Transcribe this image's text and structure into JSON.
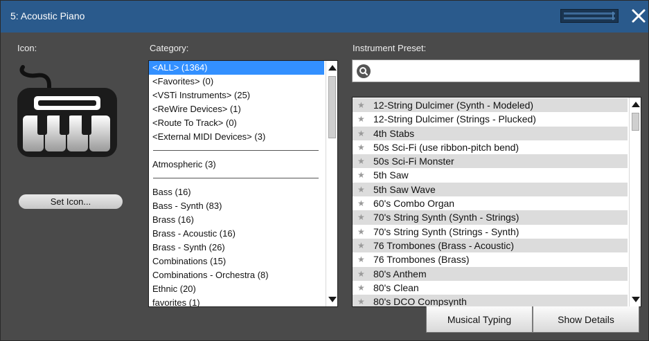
{
  "window": {
    "title": "5: Acoustic Piano"
  },
  "icon_section": {
    "label": "Icon:",
    "set_icon_label": "Set Icon..."
  },
  "category": {
    "label": "Category:",
    "groups": [
      [
        "<ALL> (1364)",
        "<Favorites> (0)",
        "<VSTi Instruments> (25)",
        "<ReWire Devices> (1)",
        "<Route To Track> (0)",
        "<External MIDI Devices> (3)"
      ],
      [
        "Atmospheric (3)"
      ],
      [
        "Bass (16)",
        "Bass - Synth (83)",
        "Brass (16)",
        "Brass - Acoustic (16)",
        "Brass - Synth (26)",
        "Combinations (15)",
        "Combinations - Orchestra (8)",
        "Ethnic (20)",
        "favorites (1)"
      ]
    ],
    "selected": "<ALL> (1364)"
  },
  "preset": {
    "label": "Instrument Preset:",
    "search_placeholder": "",
    "search_value": "",
    "items": [
      "12-String Dulcimer (Synth - Modeled)",
      "12-String Dulcimer (Strings - Plucked)",
      "4th Stabs",
      "50s Sci-Fi (use ribbon-pitch bend)",
      "50s Sci-Fi Monster",
      "5th Saw",
      "5th Saw Wave",
      "60's Combo Organ",
      "70's String Synth (Synth - Strings)",
      "70's String Synth (Strings - Synth)",
      "76 Trombones (Brass - Acoustic)",
      "76 Trombones (Brass)",
      "80's Anthem",
      "80's Clean",
      "80's DCO Compsynth"
    ]
  },
  "buttons": {
    "musical_typing": "Musical Typing",
    "show_details": "Show Details"
  },
  "colors": {
    "titlebar": "#2a5a8c",
    "panel": "#4a4a4a",
    "selection": "#3390ff"
  },
  "icons": {
    "close": "close-icon",
    "search": "search-icon",
    "favorite": "star-icon",
    "instrument": "keyboard-icon"
  }
}
